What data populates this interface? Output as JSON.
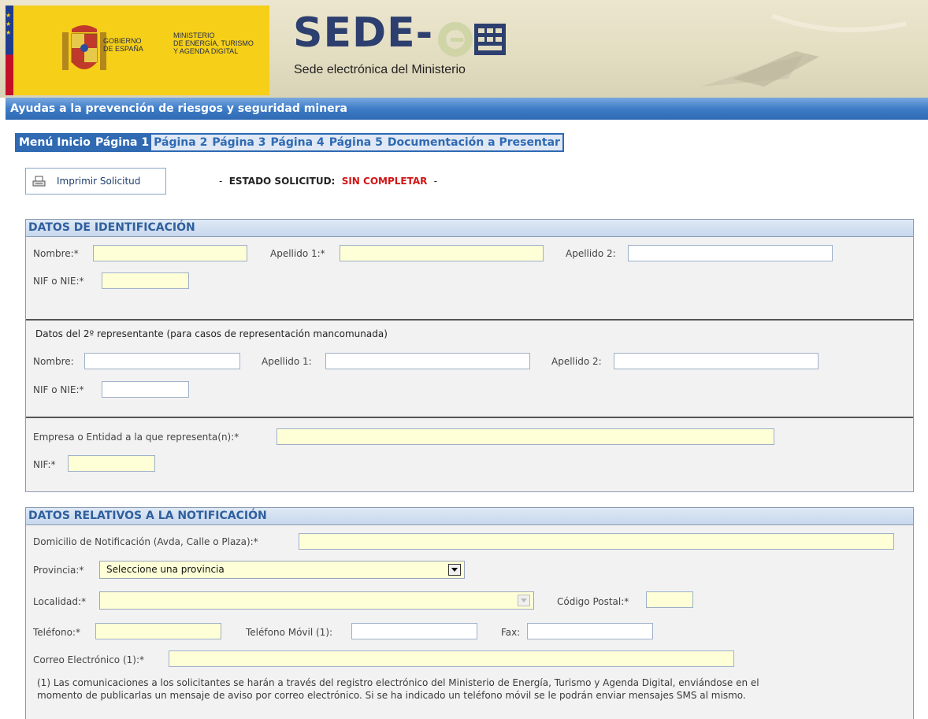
{
  "banner": {
    "gov_line1": "GOBIERNO",
    "gov_line2": "DE ESPAÑA",
    "ministry_line1": "MINISTERIO",
    "ministry_line2": "DE ENERGÍA, TURISMO",
    "ministry_line3": "Y AGENDA DIGITAL",
    "logo_text": "SEDE-",
    "logo_subtitle": "Sede electrónica del Ministerio"
  },
  "page_title": "Ayudas a la prevención de riesgos y seguridad minera",
  "tabs": [
    {
      "label": "Menú Inicio",
      "active": true
    },
    {
      "label": "Página 1",
      "active": true
    },
    {
      "label": "Página 2",
      "active": false
    },
    {
      "label": "Página 3",
      "active": false
    },
    {
      "label": "Página 4",
      "active": false
    },
    {
      "label": "Página 5",
      "active": false
    },
    {
      "label": "Documentación a Presentar",
      "active": false
    }
  ],
  "print_button": "Imprimir Solicitud",
  "status": {
    "dash": "-",
    "label": "ESTADO SOLICITUD:",
    "value": "SIN COMPLETAR"
  },
  "identification": {
    "title": "DATOS DE IDENTIFICACIÓN",
    "nombre_label": "Nombre:*",
    "apellido1_label": "Apellido 1:*",
    "apellido2_label": "Apellido 2:",
    "nif_label": "NIF o NIE:*",
    "rep2_title": "Datos del 2º representante (para casos de representación mancomunada)",
    "rep2_nombre_label": "Nombre:",
    "rep2_apellido1_label": "Apellido 1:",
    "rep2_apellido2_label": "Apellido 2:",
    "rep2_nif_label": "NIF o NIE:*",
    "empresa_label": "Empresa o Entidad a la que representa(n):*",
    "empresa_nif_label": "NIF:*"
  },
  "notification": {
    "title": "DATOS RELATIVOS A LA NOTIFICACIÓN",
    "domicilio_label": "Domicilio de Notificación (Avda, Calle o Plaza):*",
    "provincia_label": "Provincia:*",
    "provincia_value": "Seleccione una provincia",
    "localidad_label": "Localidad:*",
    "cp_label": "Código Postal:*",
    "telefono_label": "Teléfono:*",
    "movil_label": "Teléfono Móvil (1):",
    "fax_label": "Fax:",
    "correo_label": "Correo Electrónico (1):*",
    "note_line1": "(1) Las comunicaciones a los solicitantes se harán a través del registro electrónico del Ministerio de Energía, Turismo y Agenda Digital, enviándose en el",
    "note_line2": "momento de publicarlas un mensaje de aviso por correo electrónico. Si se ha indicado un teléfono móvil se le podrán enviar mensajes SMS al mismo."
  },
  "colors": {
    "accent": "#2f6ab3",
    "required_field": "#ffffd7",
    "status_value": "#d21414"
  }
}
